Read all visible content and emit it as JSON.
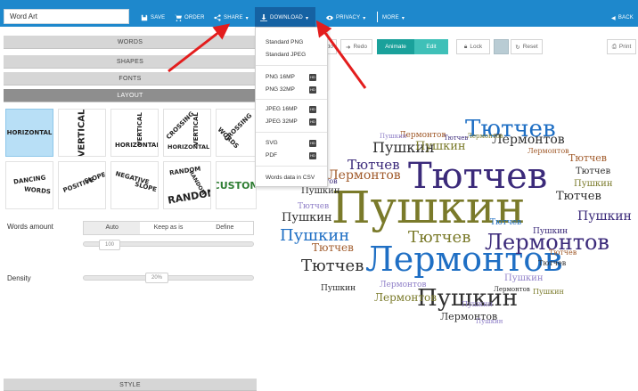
{
  "topbar": {
    "title_value": "Word Art",
    "buttons": {
      "save": "SAVE",
      "order": "ORDER",
      "share": "SHARE",
      "download": "DOWNLOAD",
      "privacy": "PRIVACY",
      "more": "MORE",
      "back": "BACK"
    }
  },
  "sections": {
    "words": "WORDS",
    "shapes": "SHAPES",
    "fonts": "FONTS",
    "layout": "LAYOUT",
    "style": "STYLE"
  },
  "layouts": {
    "horizontal": "HORIZONTAL",
    "vertical": "VERTICAL",
    "hv_vertical": "VERTICAL",
    "hv_horizontal": "HORIZONTAL",
    "crossing_a": "CROSSING",
    "crossing_b": "VERTICAL",
    "crossing_c": "HORIZONTAL",
    "cw_words": "CROSSING",
    "cw_crossing": "WORDS",
    "cw_c": "CROSSING",
    "dancing": "DANCING",
    "dancing_words": "WORDS",
    "positive": "POSITIVE",
    "positive_slope": "SLOPE",
    "negative": "NEGATIVE",
    "negative_slope": "SLOPE",
    "random_a": "RANDOM",
    "random_b": "RANDOM",
    "random_c": "RANDOM",
    "custom": "CUSTOM"
  },
  "settings": {
    "words_amount_label": "Words amount",
    "words_amount_options": [
      "Auto",
      "Keep as is",
      "Define"
    ],
    "words_amount_value": "100",
    "density_label": "Density",
    "density_value": "20%"
  },
  "cloud_toolbar": {
    "undo_partial": "ndo",
    "redo": "Redo",
    "animate": "Animate",
    "edit": "Edit",
    "lock": "Lock",
    "reset": "Reset",
    "print": "Print"
  },
  "dropdown": {
    "items": [
      "Standard PNG",
      "Standard JPEG",
      "PNG 16MP",
      "PNG 32MP",
      "JPEG 16MP",
      "JPEG 32MP",
      "SVG",
      "PDF",
      "Words data in CSV"
    ],
    "badge": "HD"
  },
  "cloud_words": [
    "Пушкин",
    "Лермонтов",
    "Тютчев",
    "Лермонтов",
    "Тютчев",
    "Пушкин",
    "Пушкин",
    "Лермонтов",
    "Тютчев",
    "Пушкин",
    "Лермонтов",
    "Тютчев",
    "Пушкин",
    "Тютчев",
    "Пушкин",
    "Лермонтов",
    "Тютчев",
    "Пушкин",
    "Тютчев",
    "Пушкин",
    "Лермонтов",
    "Тютчев",
    "Пушкин",
    "Лермонтов",
    "Тютчев",
    "Пушкин",
    "Тютчев",
    "Пушкин",
    "Лермонтов",
    "Лермонтов",
    "Тютчев",
    "Пушкин",
    "Тютчев",
    "Пушкин",
    "Лермонтов",
    "Тютчев",
    "Лермонтов",
    "Пушкин",
    "Тютчев",
    "Пушкин",
    "Лермонтов",
    "Пушкин"
  ],
  "colors": {
    "topbar": "#1e88cc",
    "accent_teal": "#1aa19b",
    "selected_tile": "#b8dff6",
    "arrow": "#e31d1d",
    "word_purple": "#3b2a7a",
    "word_blue": "#1f6fc4",
    "word_olive": "#7a7a2a",
    "word_brown": "#a05a2a",
    "word_dark": "#2f2f2f",
    "word_lavender": "#9080c8"
  }
}
